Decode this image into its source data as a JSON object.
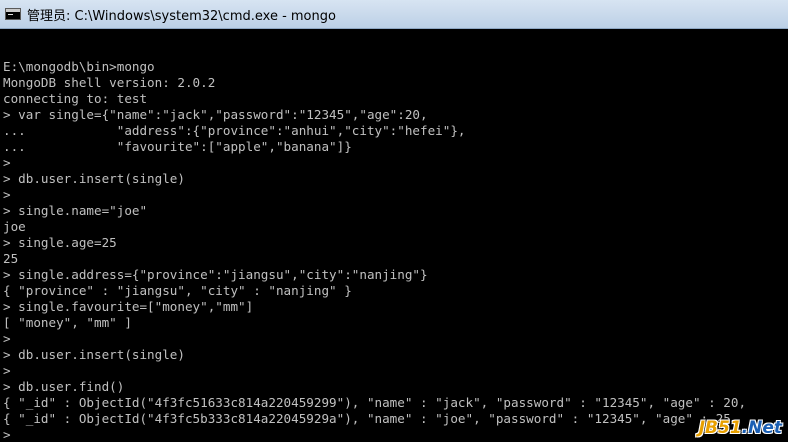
{
  "window": {
    "title": "管理员: C:\\Windows\\system32\\cmd.exe - mongo",
    "icon": "cmd-icon",
    "colors": {
      "console_background": "#000000",
      "console_text": "#c0c0c0",
      "titlebar": "#c4d6ea"
    }
  },
  "console": {
    "lines": [
      "",
      "E:\\mongodb\\bin>mongo",
      "MongoDB shell version: 2.0.2",
      "connecting to: test",
      "> var single={\"name\":\"jack\",\"password\":\"12345\",\"age\":20,",
      "...            \"address\":{\"province\":\"anhui\",\"city\":\"hefei\"},",
      "...            \"favourite\":[\"apple\",\"banana\"]}",
      ">",
      "> db.user.insert(single)",
      ">",
      "> single.name=\"joe\"",
      "joe",
      "> single.age=25",
      "25",
      "> single.address={\"province\":\"jiangsu\",\"city\":\"nanjing\"}",
      "{ \"province\" : \"jiangsu\", \"city\" : \"nanjing\" }",
      "> single.favourite=[\"money\",\"mm\"]",
      "[ \"money\", \"mm\" ]",
      ">",
      "> db.user.insert(single)",
      ">",
      "> db.user.find()",
      "{ \"_id\" : ObjectId(\"4f3fc51633c814a220459299\"), \"name\" : \"jack\", \"password\" : \"12345\", \"age\" : 20,",
      "{ \"_id\" : ObjectId(\"4f3fc5b333c814a22045929a\"), \"name\" : \"joe\", \"password\" : \"12345\", \"age\" : 25,",
      ">"
    ]
  },
  "watermark": {
    "part1": "JB51",
    "part2": ".Net"
  }
}
